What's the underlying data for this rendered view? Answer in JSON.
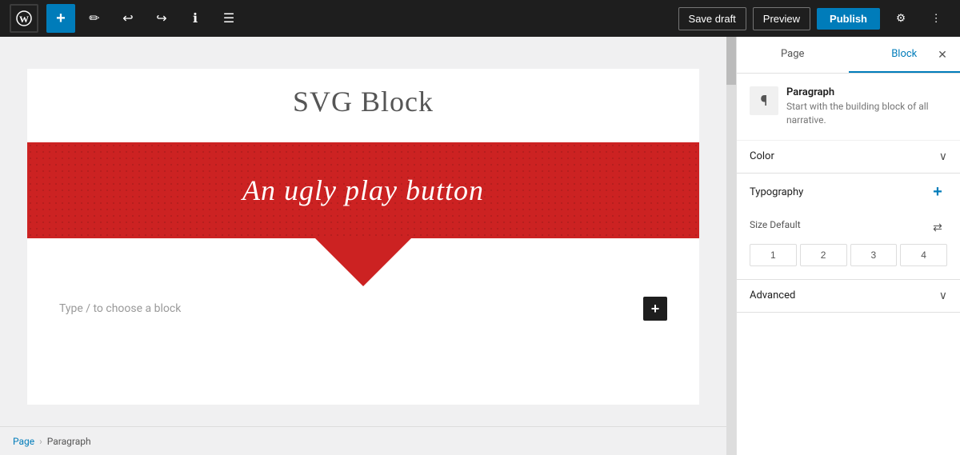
{
  "toolbar": {
    "wp_logo": "W",
    "add_label": "+",
    "save_draft_label": "Save draft",
    "preview_label": "Preview",
    "publish_label": "Publish",
    "tools": [
      "✏",
      "↩",
      "↪",
      "ℹ",
      "☰"
    ]
  },
  "editor": {
    "post_title": "SVG Block",
    "banner_text": "An ugly play button",
    "placeholder_text": "Type / to choose a block"
  },
  "breadcrumb": {
    "items": [
      "Page",
      "Paragraph"
    ],
    "separator": "›"
  },
  "sidebar": {
    "tabs": [
      {
        "label": "Page",
        "active": false
      },
      {
        "label": "Block",
        "active": true
      }
    ],
    "block": {
      "icon": "¶",
      "title": "Paragraph",
      "description": "Start with the building block of all narrative."
    },
    "sections": [
      {
        "id": "color",
        "title": "Color",
        "expanded": false
      },
      {
        "id": "typography",
        "title": "Typography",
        "expanded": true,
        "size_label": "Size",
        "size_default": "Default",
        "size_options": [
          "1",
          "2",
          "3",
          "4"
        ]
      },
      {
        "id": "advanced",
        "title": "Advanced",
        "expanded": false
      }
    ]
  }
}
